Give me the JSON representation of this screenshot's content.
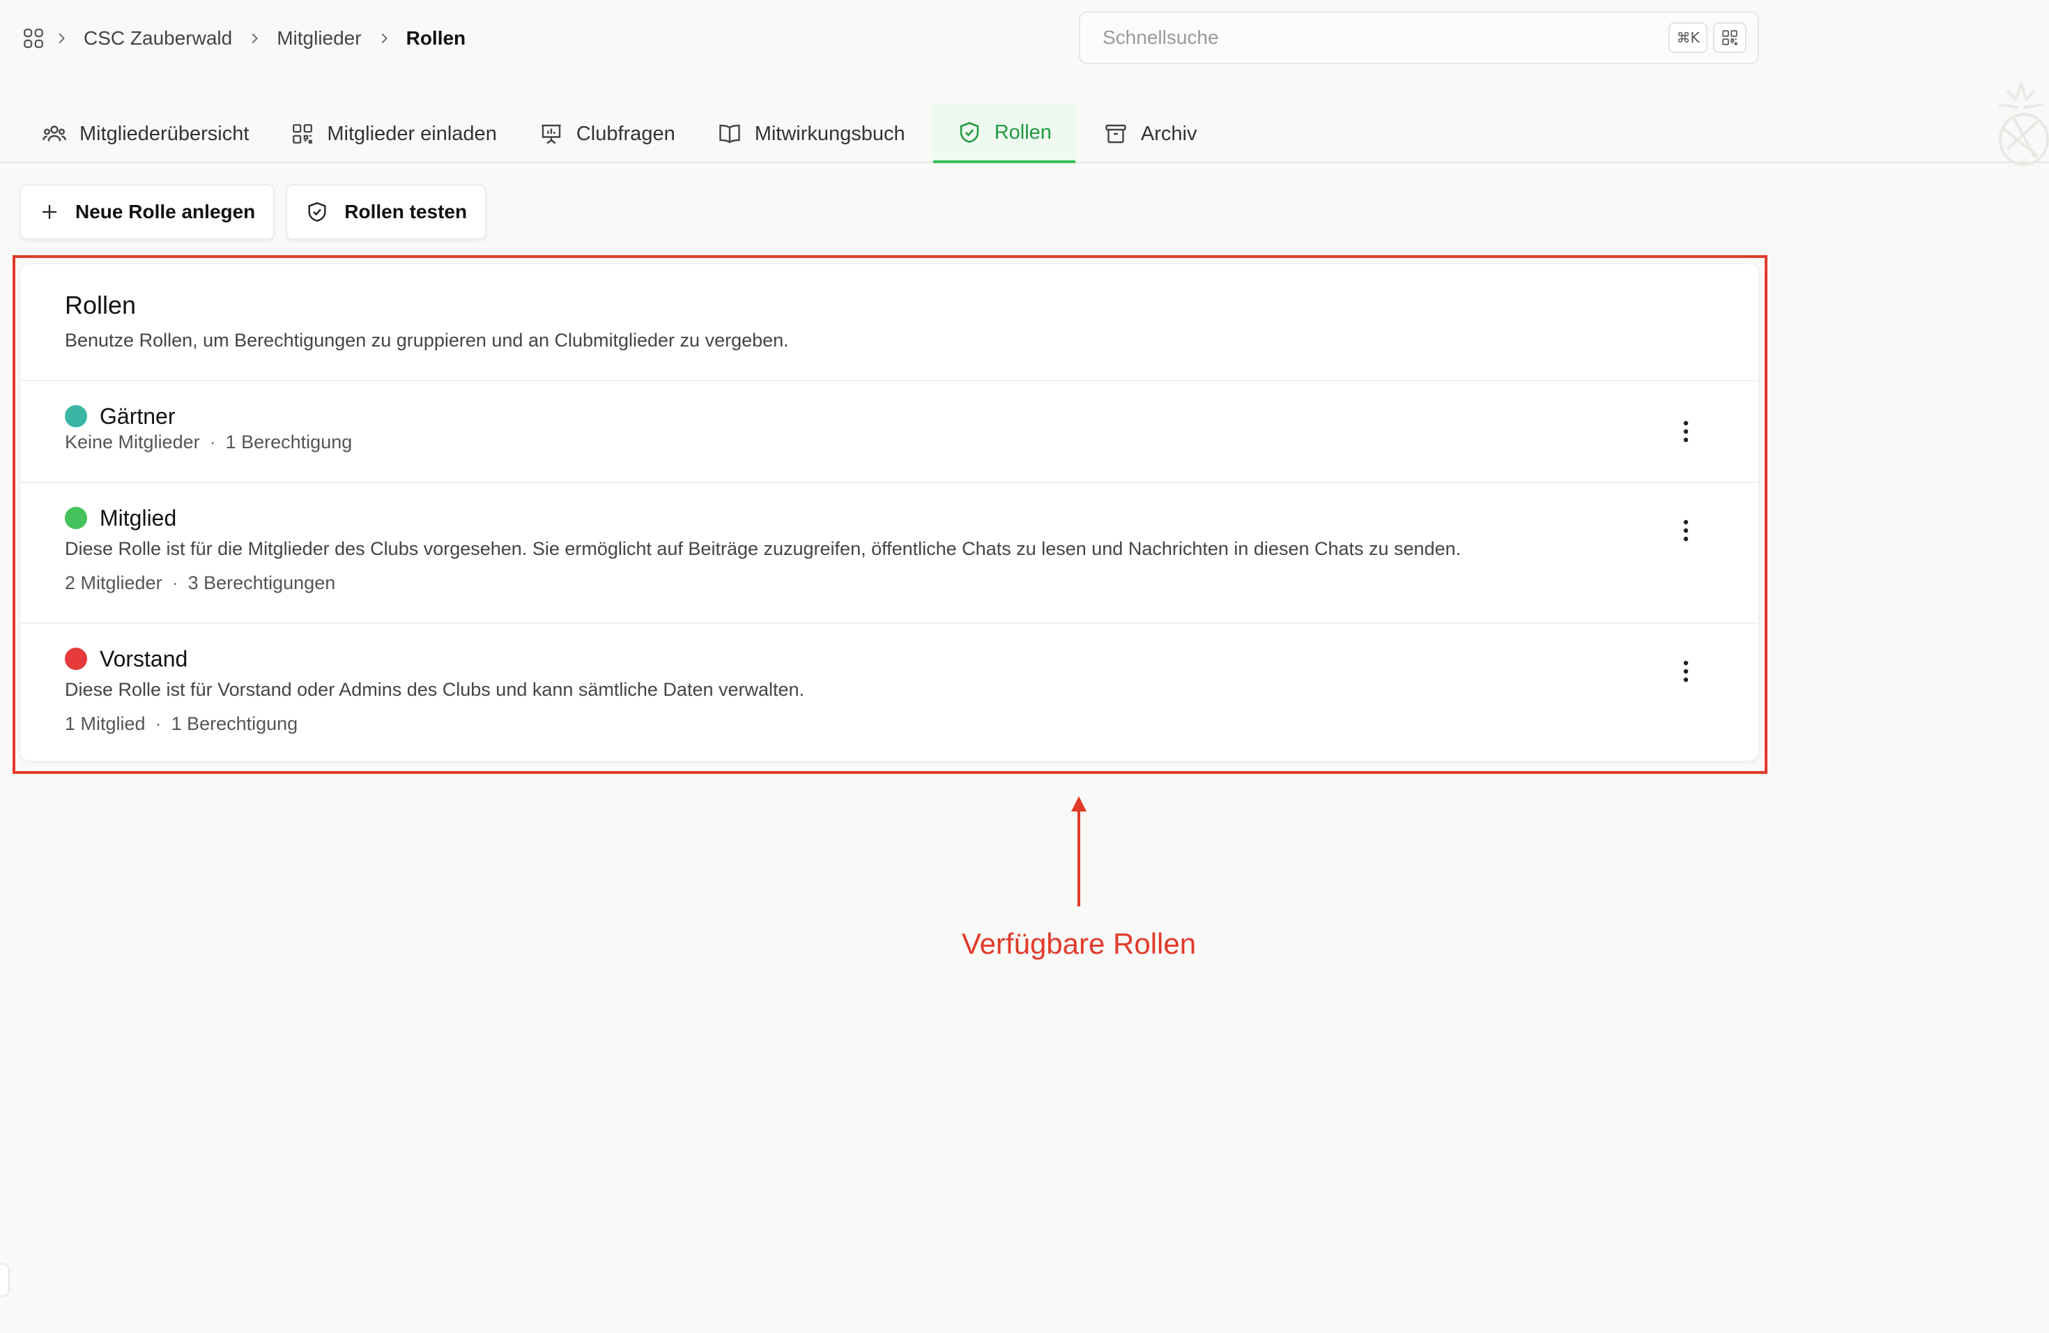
{
  "breadcrumb": {
    "items": [
      "CSC Zauberwald",
      "Mitglieder"
    ],
    "current": "Rollen"
  },
  "search": {
    "placeholder": "Schnellsuche",
    "shortcut": "⌘K"
  },
  "tabs": [
    {
      "label": "Mitgliederübersicht",
      "icon": "users-icon"
    },
    {
      "label": "Mitglieder einladen",
      "icon": "qr-code-icon"
    },
    {
      "label": "Clubfragen",
      "icon": "presentation-chart-icon"
    },
    {
      "label": "Mitwirkungsbuch",
      "icon": "book-icon"
    },
    {
      "label": "Rollen",
      "icon": "shield-check-icon",
      "active": true
    },
    {
      "label": "Archiv",
      "icon": "archive-icon"
    }
  ],
  "actions": {
    "new_role": "Neue Rolle anlegen",
    "test_roles": "Rollen testen"
  },
  "roles_card": {
    "title": "Rollen",
    "description": "Benutze Rollen, um Berechtigungen zu gruppieren und an Clubmitglieder zu vergeben.",
    "roles": [
      {
        "name": "Gärtner",
        "color": "#3ab5a4",
        "description": "",
        "members": "Keine Mitglieder",
        "permissions": "1 Berechtigung"
      },
      {
        "name": "Mitglied",
        "color": "#45c25c",
        "description": "Diese Rolle ist für die Mitglieder des Clubs vorgesehen. Sie ermöglicht auf Beiträge zuzugreifen, öffentliche Chats zu lesen und Nachrichten in diesen Chats zu senden.",
        "members": "2 Mitglieder",
        "permissions": "3 Berechtigungen"
      },
      {
        "name": "Vorstand",
        "color": "#e5393b",
        "description": "Diese Rolle ist für Vorstand oder Admins des Clubs und kann sämtliche Daten verwalten.",
        "members": "1 Mitglied",
        "permissions": "1 Berechtigung"
      }
    ]
  },
  "annotation": {
    "label": "Verfügbare Rollen",
    "color": "#e23a2a"
  },
  "colors": {
    "accent": "#36c158",
    "accent_text": "#1f9a3f",
    "background": "#f9f9f8"
  }
}
